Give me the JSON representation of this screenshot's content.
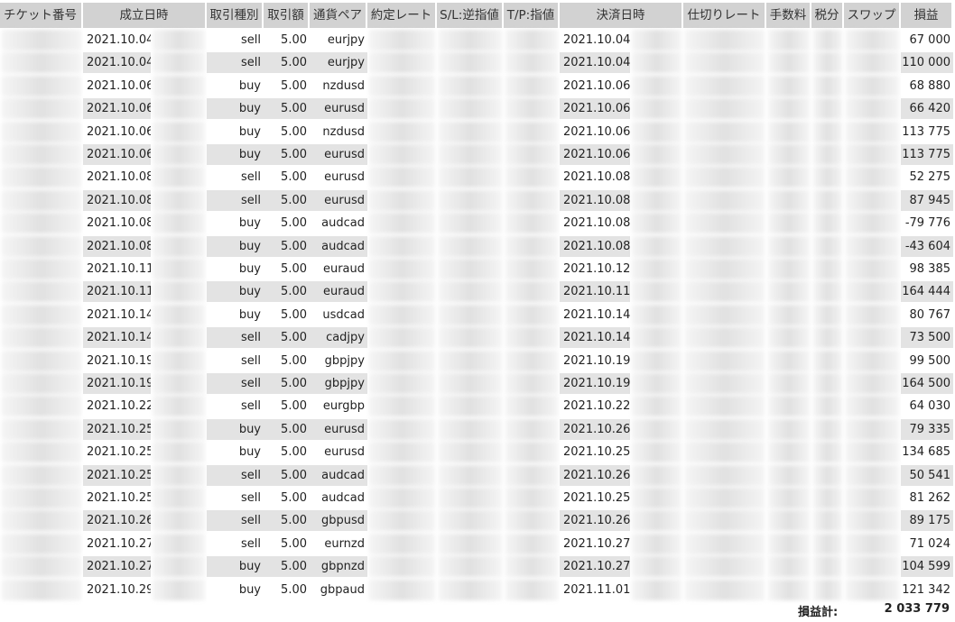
{
  "headers": {
    "ticket": "チケット番号",
    "open_time": "成立日時",
    "type": "取引種別",
    "size": "取引額",
    "pair": "通貨ペア",
    "rate": "約定レート",
    "sl": "S/L:逆指値",
    "tp": "T/P:指値",
    "close_time": "決済日時",
    "close_rate": "仕切りレート",
    "commission": "手数料",
    "tax": "税分",
    "swap": "スワップ",
    "profit": "損益"
  },
  "rows": [
    {
      "open": "2021.10.04",
      "type": "sell",
      "size": "5.00",
      "pair": "eurjpy",
      "close": "2021.10.04",
      "profit": "67 000"
    },
    {
      "open": "2021.10.04",
      "type": "sell",
      "size": "5.00",
      "pair": "eurjpy",
      "close": "2021.10.04",
      "profit": "110 000"
    },
    {
      "open": "2021.10.06",
      "type": "buy",
      "size": "5.00",
      "pair": "nzdusd",
      "close": "2021.10.06",
      "profit": "68 880"
    },
    {
      "open": "2021.10.06",
      "type": "buy",
      "size": "5.00",
      "pair": "eurusd",
      "close": "2021.10.06",
      "profit": "66 420"
    },
    {
      "open": "2021.10.06",
      "type": "buy",
      "size": "5.00",
      "pair": "nzdusd",
      "close": "2021.10.06",
      "profit": "113 775"
    },
    {
      "open": "2021.10.06",
      "type": "buy",
      "size": "5.00",
      "pair": "eurusd",
      "close": "2021.10.06",
      "profit": "113 775"
    },
    {
      "open": "2021.10.08",
      "type": "sell",
      "size": "5.00",
      "pair": "eurusd",
      "close": "2021.10.08",
      "profit": "52 275"
    },
    {
      "open": "2021.10.08",
      "type": "sell",
      "size": "5.00",
      "pair": "eurusd",
      "close": "2021.10.08",
      "profit": "87 945"
    },
    {
      "open": "2021.10.08",
      "type": "buy",
      "size": "5.00",
      "pair": "audcad",
      "close": "2021.10.08",
      "profit": "-79 776"
    },
    {
      "open": "2021.10.08",
      "type": "buy",
      "size": "5.00",
      "pair": "audcad",
      "close": "2021.10.08",
      "profit": "-43 604"
    },
    {
      "open": "2021.10.11",
      "type": "buy",
      "size": "5.00",
      "pair": "euraud",
      "close": "2021.10.12",
      "profit": "98 385"
    },
    {
      "open": "2021.10.11",
      "type": "buy",
      "size": "5.00",
      "pair": "euraud",
      "close": "2021.10.11",
      "profit": "164 444"
    },
    {
      "open": "2021.10.14",
      "type": "buy",
      "size": "5.00",
      "pair": "usdcad",
      "close": "2021.10.14",
      "profit": "80 767"
    },
    {
      "open": "2021.10.14",
      "type": "sell",
      "size": "5.00",
      "pair": "cadjpy",
      "close": "2021.10.14",
      "profit": "73 500"
    },
    {
      "open": "2021.10.19",
      "type": "sell",
      "size": "5.00",
      "pair": "gbpjpy",
      "close": "2021.10.19",
      "profit": "99 500"
    },
    {
      "open": "2021.10.19",
      "type": "sell",
      "size": "5.00",
      "pair": "gbpjpy",
      "close": "2021.10.19",
      "profit": "164 500"
    },
    {
      "open": "2021.10.22",
      "type": "sell",
      "size": "5.00",
      "pair": "eurgbp",
      "close": "2021.10.22",
      "profit": "64 030"
    },
    {
      "open": "2021.10.25",
      "type": "buy",
      "size": "5.00",
      "pair": "eurusd",
      "close": "2021.10.26",
      "profit": "79 335"
    },
    {
      "open": "2021.10.25",
      "type": "buy",
      "size": "5.00",
      "pair": "eurusd",
      "close": "2021.10.25",
      "profit": "134 685"
    },
    {
      "open": "2021.10.25",
      "type": "sell",
      "size": "5.00",
      "pair": "audcad",
      "close": "2021.10.26",
      "profit": "50 541"
    },
    {
      "open": "2021.10.25",
      "type": "sell",
      "size": "5.00",
      "pair": "audcad",
      "close": "2021.10.25",
      "profit": "81 262"
    },
    {
      "open": "2021.10.26",
      "type": "sell",
      "size": "5.00",
      "pair": "gbpusd",
      "close": "2021.10.26",
      "profit": "89 175"
    },
    {
      "open": "2021.10.27",
      "type": "sell",
      "size": "5.00",
      "pair": "eurnzd",
      "close": "2021.10.27",
      "profit": "71 024"
    },
    {
      "open": "2021.10.27",
      "type": "buy",
      "size": "5.00",
      "pair": "gbpnzd",
      "close": "2021.10.27",
      "profit": "104 599"
    },
    {
      "open": "2021.10.29",
      "type": "buy",
      "size": "5.00",
      "pair": "gbpaud",
      "close": "2021.11.01",
      "profit": "121 342"
    }
  ],
  "total": {
    "label": "損益計:",
    "value": "2 033 779"
  }
}
